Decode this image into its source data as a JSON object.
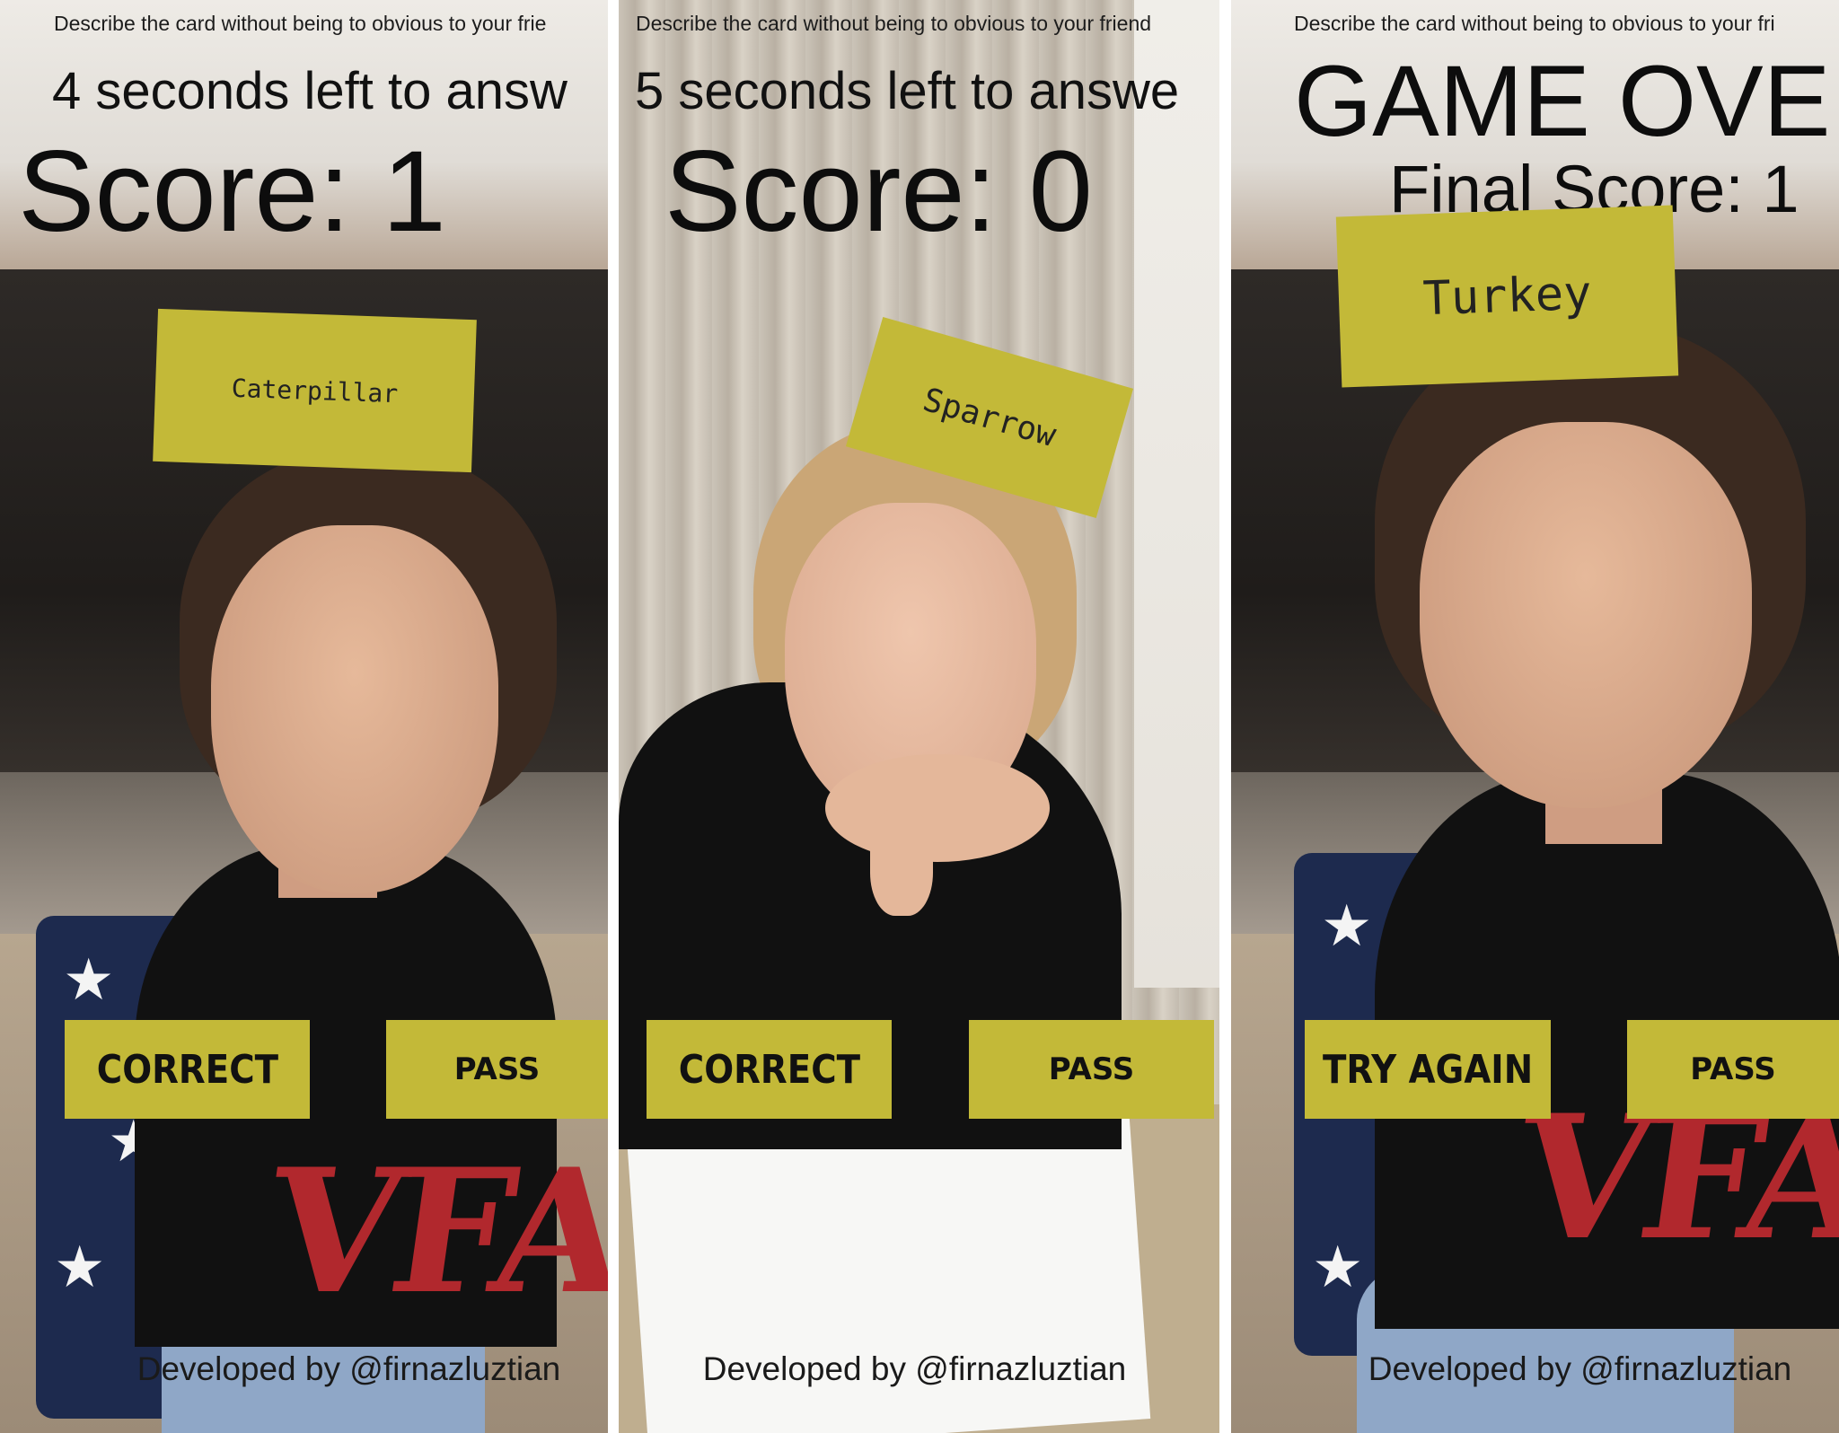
{
  "panels": [
    {
      "hint": "Describe the card without being to obvious to your frie",
      "timer": "4 seconds left to answ",
      "score": "Score: 1",
      "card": "Caterpillar",
      "buttons": {
        "left": "CORRECT",
        "right": "PASS"
      },
      "credit": "Developed by @firnazluztian"
    },
    {
      "hint": "Describe the card without being to obvious to your friend",
      "timer": "5 seconds left to answe",
      "score": "Score: 0",
      "card": "Sparrow",
      "buttons": {
        "left": "CORRECT",
        "right": "PASS"
      },
      "credit": "Developed by @firnazluztian"
    },
    {
      "hint": "Describe the card without being to obvious to your fri",
      "title": "GAME OVE",
      "final_score": "Final Score: 1",
      "card": "Turkey",
      "buttons": {
        "left": "TRY AGAIN",
        "right": "PASS"
      },
      "credit": "Developed by @firnazluztian"
    }
  ],
  "theme": {
    "card_color": "#c3b938",
    "text_color": "#111111"
  }
}
